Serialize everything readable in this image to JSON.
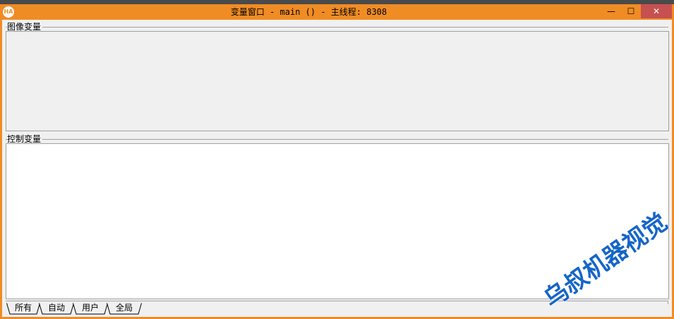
{
  "window": {
    "icon_label": "HA",
    "title": "变量窗口 - main () - 主线程: 8308",
    "minimize_label": "—",
    "maximize_label": "☐",
    "close_label": "✕"
  },
  "groups": {
    "image_vars_label": "图像变量",
    "control_vars_label": "控制变量"
  },
  "tabs": [
    {
      "label": "所有",
      "selected": true
    },
    {
      "label": "自动",
      "selected": false
    },
    {
      "label": "用户",
      "selected": false
    },
    {
      "label": "全局",
      "selected": false
    }
  ],
  "watermark": {
    "text": "乌叔机器视觉"
  },
  "colors": {
    "title_bar": "#f08c24",
    "close_button": "#c75050",
    "watermark": "#1565c8"
  }
}
